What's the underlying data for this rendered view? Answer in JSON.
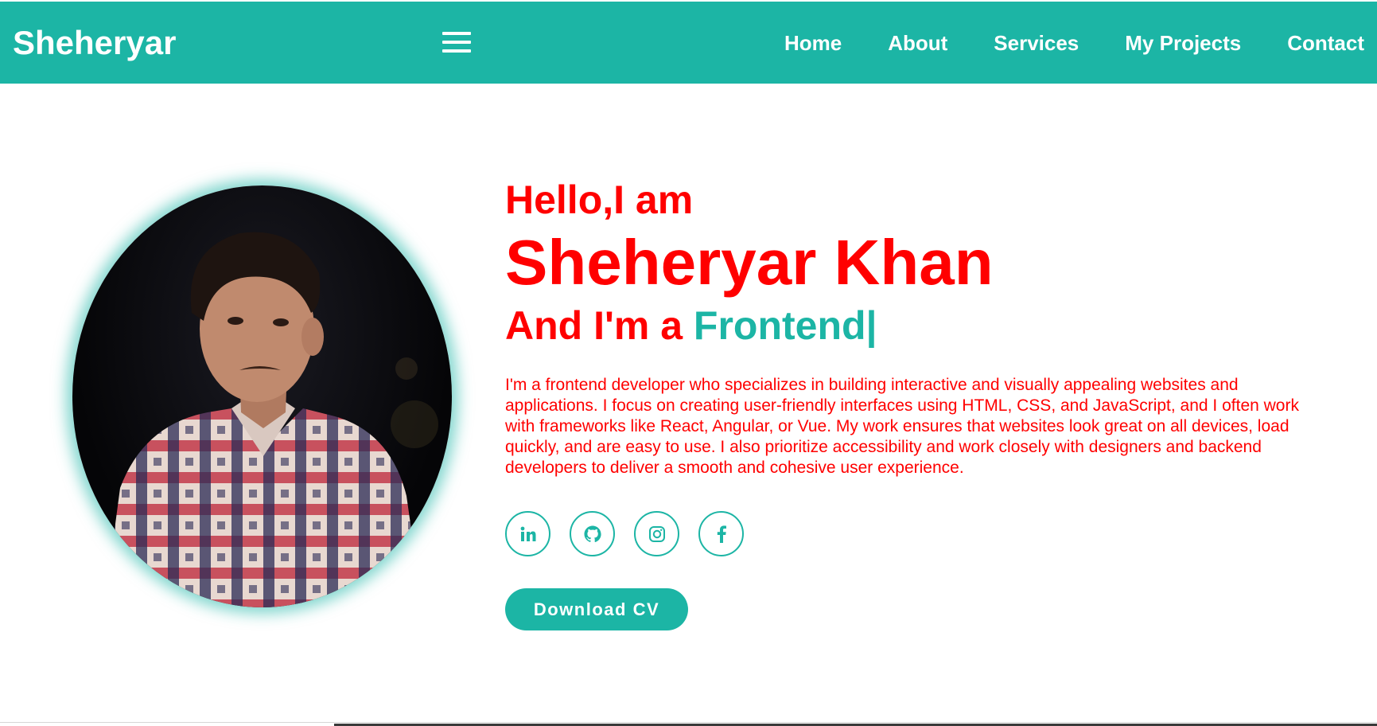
{
  "nav": {
    "brand": "Sheheryar",
    "links": [
      "Home",
      "About",
      "Services",
      "My Projects",
      "Contact"
    ]
  },
  "hero": {
    "greeting": "Hello,I am",
    "name": "Sheheryar Khan",
    "role_prefix": "And I'm a ",
    "role_typed": "Frontend|",
    "bio": "I'm a frontend developer who specializes in building interactive and visually appealing websites and applications. I focus on creating user-friendly interfaces using HTML, CSS, and JavaScript, and I often work with frameworks like React, Angular, or Vue. My work ensures that websites look great on all devices, load quickly, and are easy to use. I also prioritize accessibility and work closely with designers and backend developers to deliver a smooth and cohesive user experience.",
    "cv_button": "Download CV"
  },
  "socials": [
    "linkedin-icon",
    "github-icon",
    "instagram-icon",
    "facebook-icon"
  ],
  "colors": {
    "accent": "#1cb5a5",
    "headline": "#ff0000",
    "nav_text": "#ffffff"
  }
}
